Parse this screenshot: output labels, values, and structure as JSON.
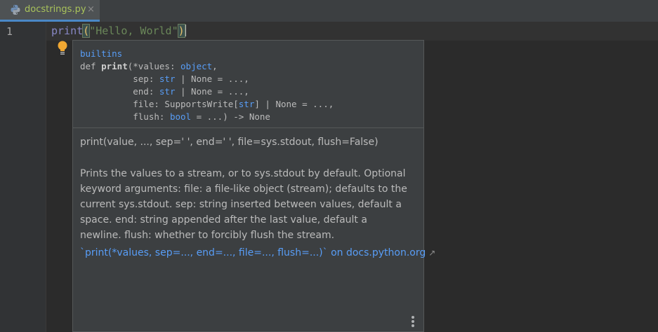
{
  "tab": {
    "filename": "docstrings.py",
    "close_glyph": "×",
    "icon": "python-file-icon"
  },
  "editor": {
    "line_number": "1",
    "code": {
      "fn": "print",
      "open_paren": "(",
      "string": "\"Hello, World\"",
      "close_paren": ")"
    }
  },
  "popup": {
    "signature": {
      "module": "builtins",
      "def": "def ",
      "name": "print",
      "line1_rest": "(*values: ",
      "line1_type": "object",
      "line1_end": ",",
      "line2_a": "          sep: ",
      "line2_type": "str",
      "line2_b": " | None = ...,",
      "line3_a": "          end: ",
      "line3_type": "str",
      "line3_b": " | None = ...,",
      "line4_a": "          file: SupportsWrite[",
      "line4_type": "str",
      "line4_b": "] | None = ...,",
      "line5_a": "          flush: ",
      "line5_type": "bool",
      "line5_b": " = ...) -> None"
    },
    "short_doc": "print(value, ..., sep=' ', end=' ', file=sys.stdout, flush=False)",
    "long_doc": "Prints the values to a stream, or to sys.stdout by default. Optional keyword arguments: file: a file-like object (stream); defaults to the current sys.stdout. sep: string inserted between values, default a space. end: string appended after the last value, default a newline. flush: whether to forcibly flush the stream.",
    "link_text": "`print(*values, sep=..., end=..., file=..., flush=...)` on docs.python.org",
    "external_glyph": "↗"
  },
  "colors": {
    "editor_bg": "#2b2b2b",
    "popup_bg": "#3c3f41",
    "link": "#589df6",
    "tab_label": "#a9c35b",
    "tab_underline": "#4a88c7"
  }
}
